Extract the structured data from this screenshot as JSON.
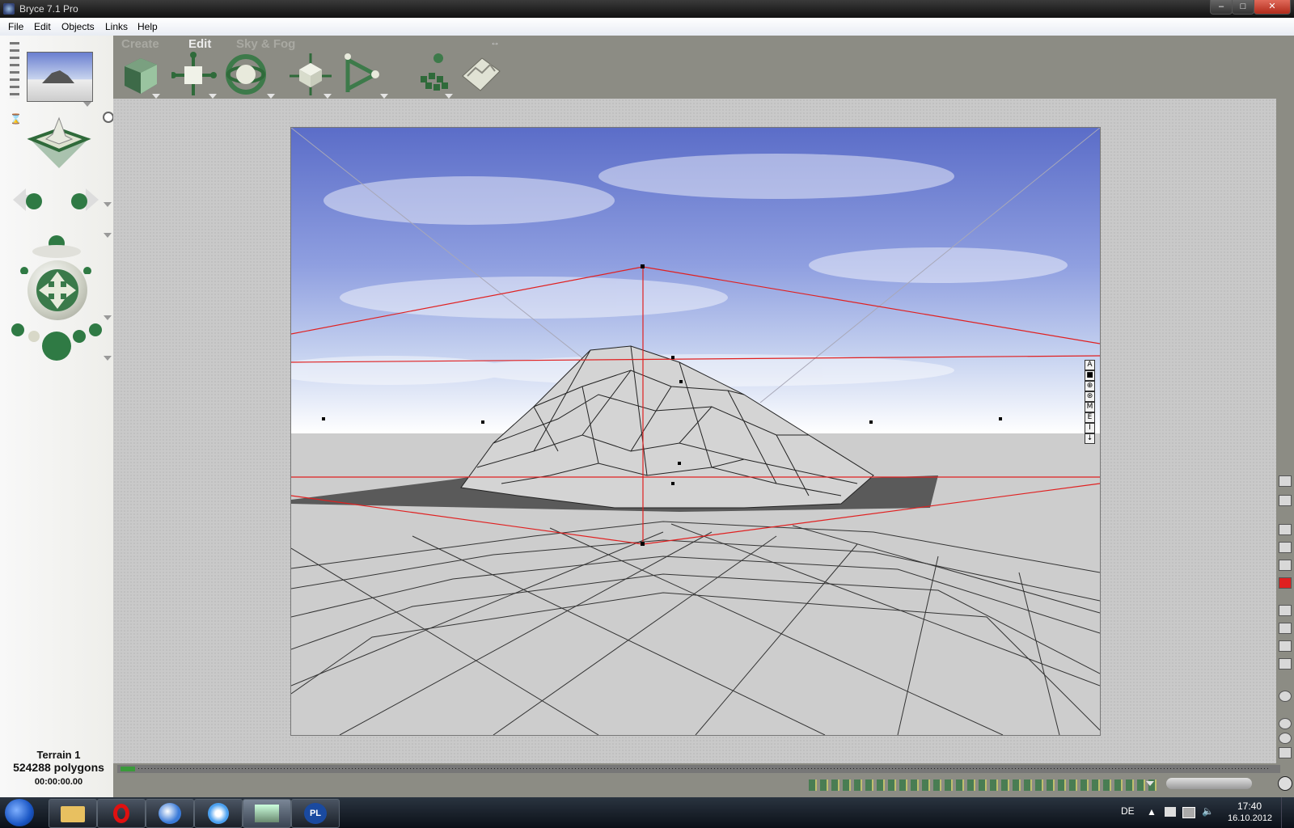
{
  "window": {
    "title": "Bryce 7.1  Pro",
    "minimize": "–",
    "maximize": "□",
    "close": "✕"
  },
  "menu": [
    "File",
    "Edit",
    "Objects",
    "Links",
    "Help"
  ],
  "toolbar": {
    "tabs": [
      "Create",
      "Edit",
      "Sky & Fog"
    ],
    "active_tab": "Edit"
  },
  "status": {
    "object_name": "Terrain 1",
    "polygons": "524288 polygons",
    "time": "00:00:00.00"
  },
  "viewport_icons": [
    "A",
    "■",
    "⊕",
    "⊛",
    "M",
    "E",
    "I",
    "↓"
  ],
  "taskbar": {
    "language": "DE",
    "time": "17:40",
    "date": "16.10.2012"
  },
  "colors": {
    "accent_red": "#e02020",
    "sky_blue": "#6a7fd0",
    "app_gray": "#8c8c84"
  }
}
